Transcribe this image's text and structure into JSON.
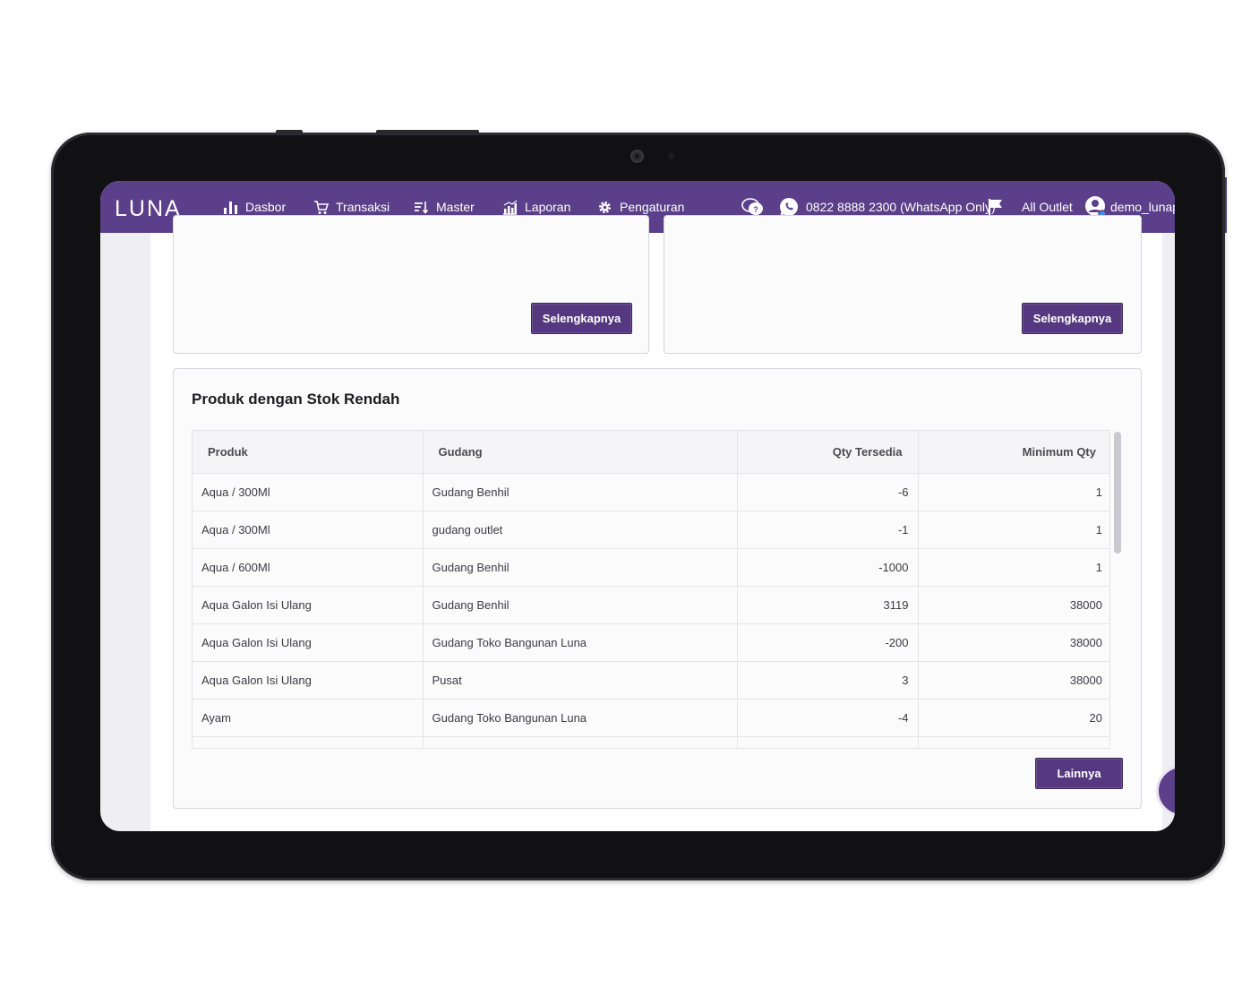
{
  "navbar": {
    "logo_text": "LUNA",
    "items": [
      {
        "label": "Dasbor",
        "icon": "bar-chart-icon"
      },
      {
        "label": "Transaksi",
        "icon": "cart-icon"
      },
      {
        "label": "Master",
        "icon": "sort-icon"
      },
      {
        "label": "Laporan",
        "icon": "report-chart-icon"
      },
      {
        "label": "Pengaturan",
        "icon": "gear-icon"
      }
    ],
    "help_icon": "chat-help-icon",
    "phone": "0822 8888 2300 (WhatsApp Only)",
    "outlet": "All Outlet",
    "user": "demo_lunap"
  },
  "top_cards": {
    "left_button": "Selengkapnya",
    "right_button": "Selengkapnya"
  },
  "low_stock": {
    "title": "Produk dengan Stok Rendah",
    "columns": [
      "Produk",
      "Gudang",
      "Qty Tersedia",
      "Minimum Qty"
    ],
    "rows": [
      [
        "Aqua / 300Ml",
        "Gudang Benhil",
        "-6",
        "1"
      ],
      [
        "Aqua / 300Ml",
        "gudang outlet",
        "-1",
        "1"
      ],
      [
        "Aqua / 600Ml",
        "Gudang Benhil",
        "-1000",
        "1"
      ],
      [
        "Aqua Galon Isi Ulang",
        "Gudang Benhil",
        "3119",
        "38000"
      ],
      [
        "Aqua Galon Isi Ulang",
        "Gudang Toko Bangunan Luna",
        "-200",
        "38000"
      ],
      [
        "Aqua Galon Isi Ulang",
        "Pusat",
        "3",
        "38000"
      ],
      [
        "Ayam",
        "Gudang Toko Bangunan Luna",
        "-4",
        "20"
      ]
    ],
    "more_button": "Lainnya"
  },
  "colors": {
    "brand": "#5b3f8a",
    "button": "#55387f"
  }
}
